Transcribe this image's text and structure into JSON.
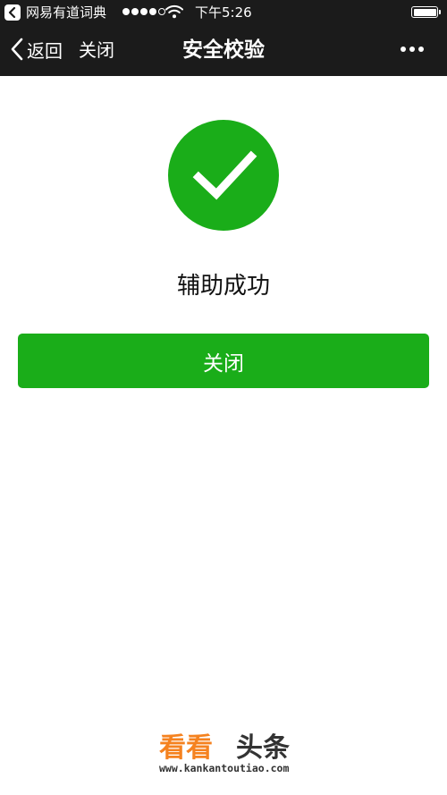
{
  "status_bar": {
    "back_app_label": "网易有道词典",
    "time": "下午5:26",
    "battery_level": 1.0
  },
  "nav_bar": {
    "back_label": "返回",
    "close_label": "关闭",
    "title": "安全校验"
  },
  "content": {
    "result_text": "辅助成功",
    "close_button_label": "关闭"
  },
  "watermark": {
    "brand_highlight": "看看",
    "brand_rest": "头条",
    "url": "www.kankantoutiao.com"
  },
  "colors": {
    "nav_background": "#1b1b1b",
    "success_green": "#1aad19",
    "page_background": "#ffffff",
    "watermark_orange": "#f5821f"
  },
  "icons": [
    "app-back-icon",
    "signal-dots-icon",
    "wifi-icon",
    "battery-icon",
    "chevron-left-icon",
    "more-dots-icon",
    "check-circle-icon"
  ]
}
